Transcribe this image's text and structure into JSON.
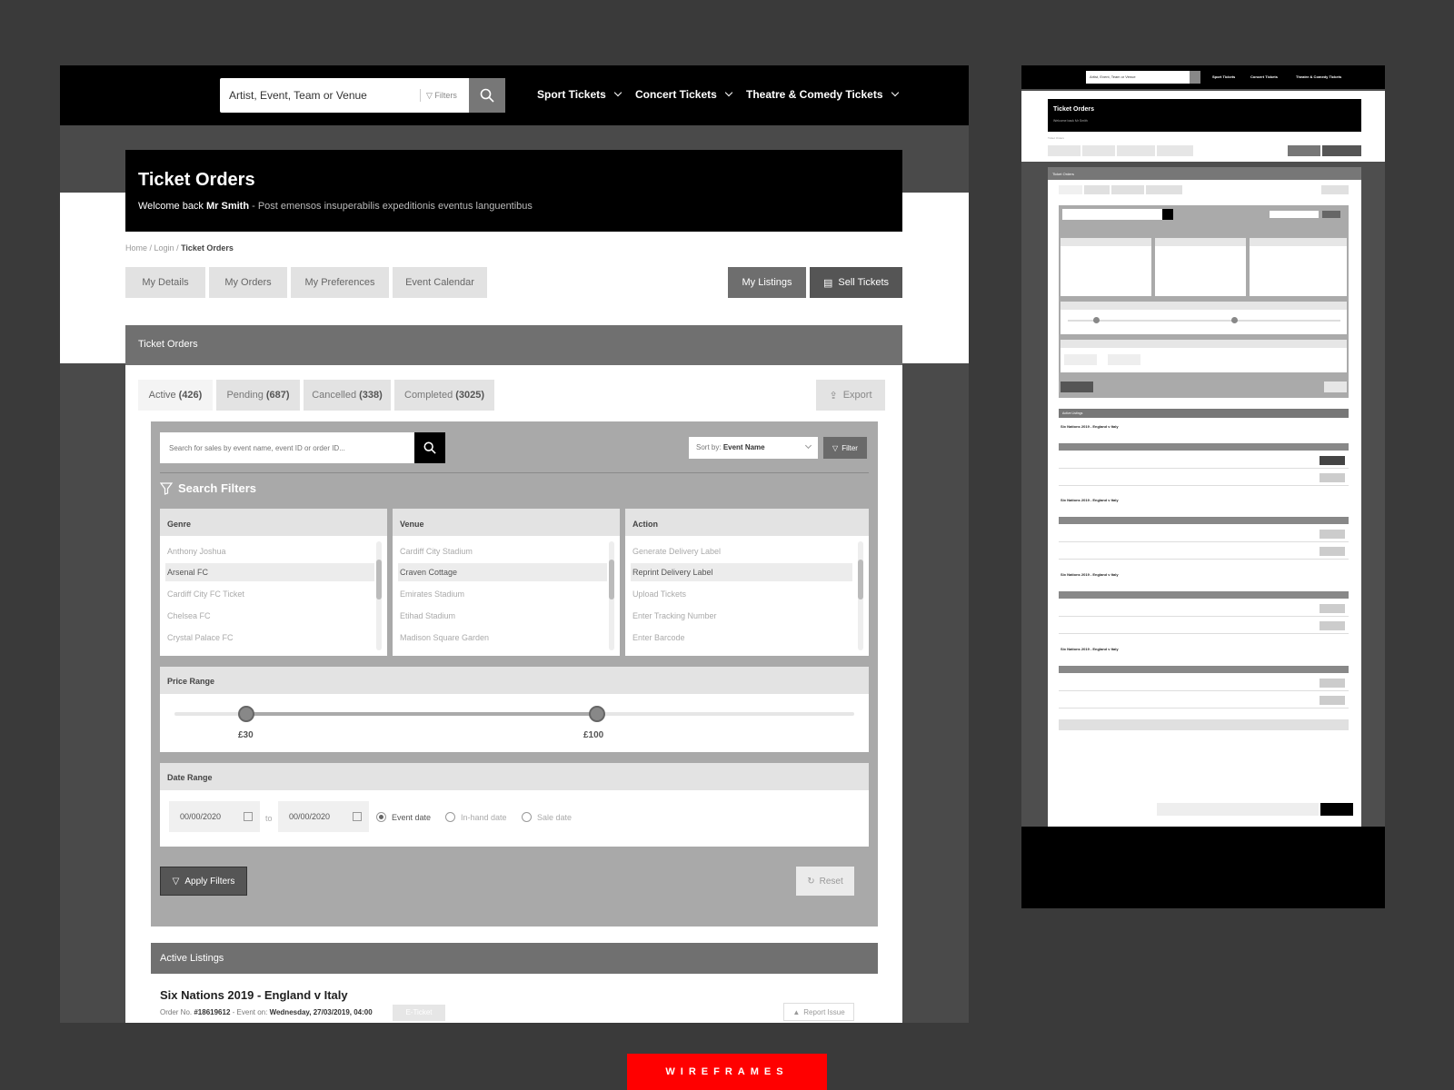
{
  "header": {
    "search_placeholder": "Artist, Event, Team or Venue",
    "filters_label": "Filters",
    "nav": [
      "Sport Tickets",
      "Concert Tickets",
      "Theatre & Comedy Tickets"
    ]
  },
  "hero": {
    "title": "Ticket Orders",
    "welcome": "Welcome back",
    "user": "Mr Smith",
    "tagline": "- Post emensos insuperabilis expeditionis eventus languentibus"
  },
  "breadcrumb": {
    "home": "Home",
    "sep1": " / ",
    "login": "Login",
    "sep2": " / ",
    "current": "Ticket Orders"
  },
  "page_tabs": [
    "My Details",
    "My Orders",
    "My Preferences",
    "Event Calendar"
  ],
  "page_actions": {
    "listings": "My Listings",
    "sell": "Sell Tickets"
  },
  "card": {
    "title": "Ticket Orders",
    "order_tabs": [
      {
        "label": "Active",
        "count": "(426)"
      },
      {
        "label": "Pending",
        "count": "(687)"
      },
      {
        "label": "Cancelled",
        "count": "(338)"
      },
      {
        "label": "Completed",
        "count": "(3025)"
      }
    ],
    "export": "Export"
  },
  "filters": {
    "search_placeholder": "Search for sales by event name, event ID or order ID...",
    "sort_label": "Sort by:",
    "sort_value": "Event Name",
    "filter_btn": "Filter",
    "title": "Search Filters",
    "genre": {
      "header": "Genre",
      "items": [
        "Anthony Joshua",
        "Arsenal FC",
        "Cardiff City FC Ticket",
        "Chelsea FC",
        "Crystal Palace FC"
      ],
      "selected": 1
    },
    "venue": {
      "header": "Venue",
      "items": [
        "Cardiff City Stadium",
        "Craven Cottage",
        "Emirates Stadium",
        "Etihad Stadium",
        "Madison Square Garden"
      ],
      "selected": 1
    },
    "action": {
      "header": "Action",
      "items": [
        "Generate Delivery Label",
        "Reprint Delivery Label",
        "Upload Tickets",
        "Enter Tracking Number",
        "Enter Barcode"
      ],
      "selected": 1
    },
    "price": {
      "header": "Price Range",
      "min": "£30",
      "max": "£100"
    },
    "date": {
      "header": "Date Range",
      "from": "00/00/2020",
      "to_label": "to",
      "to": "00/00/2020",
      "options": [
        "Event date",
        "In-hand date",
        "Sale date"
      ],
      "selected": 0
    },
    "apply": "Apply Filters",
    "reset": "Reset"
  },
  "listings": {
    "header": "Active Listings",
    "event_title": "Six Nations 2019 - England v Italy",
    "order_label": "Order No.",
    "order_no": "#18619612",
    "event_on_label": "- Event on:",
    "event_on": "Wednesday, 27/03/2019, 04:00",
    "eticket": "E-Ticket",
    "report": "Report Issue"
  },
  "badge": "WIREFRAMES",
  "colors": {
    "accent": "#ff0000",
    "header_bg": "#000000",
    "panel_bg": "#a9a9a9"
  }
}
